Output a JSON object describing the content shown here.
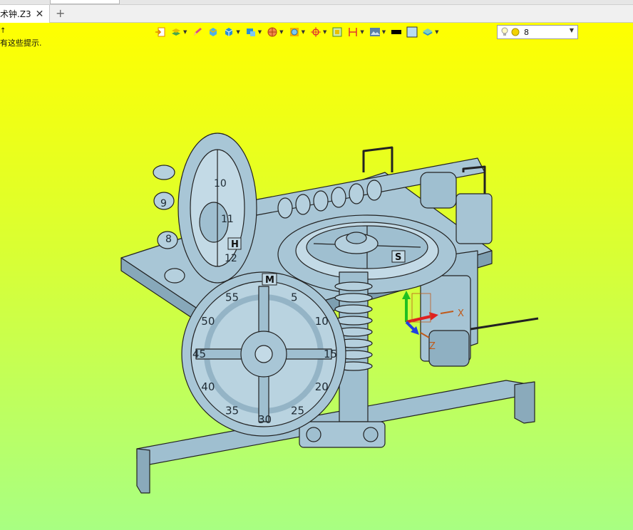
{
  "tab": {
    "title": "术钟.Z3",
    "close_glyph": "✕"
  },
  "new_tab_glyph": "+",
  "viewport": {
    "hint_text": "有这些提示."
  },
  "toolbar": {
    "layer_select_value": "8",
    "icons": [
      "import-icon",
      "layers-icon",
      "pencil-icon",
      "box-icon",
      "cube-icon",
      "view-cube-icon",
      "section-icon",
      "render-icon",
      "center-icon",
      "frame-icon",
      "dimension-icon",
      "image-icon",
      "line-color-swatch",
      "fill-color-swatch",
      "stack-icon",
      "bulb-icon"
    ]
  },
  "colors": {
    "viewport_top": "#ffff00",
    "viewport_bottom": "#a8ff82",
    "model": "#9fbfd0",
    "model_edge": "#222222",
    "axis_x": "#e02020",
    "axis_y": "#20c020",
    "axis_z": "#2040e0"
  },
  "model": {
    "dial_numbers": [
      "5",
      "10",
      "15",
      "20",
      "25",
      "30",
      "35",
      "40",
      "45",
      "50",
      "55"
    ],
    "hour_numbers": [
      "10",
      "11",
      "12",
      "9",
      "8"
    ],
    "labels": {
      "minute": "M",
      "hour": "H",
      "second": "S"
    },
    "triad": {
      "x": "X",
      "z": "Z"
    }
  }
}
